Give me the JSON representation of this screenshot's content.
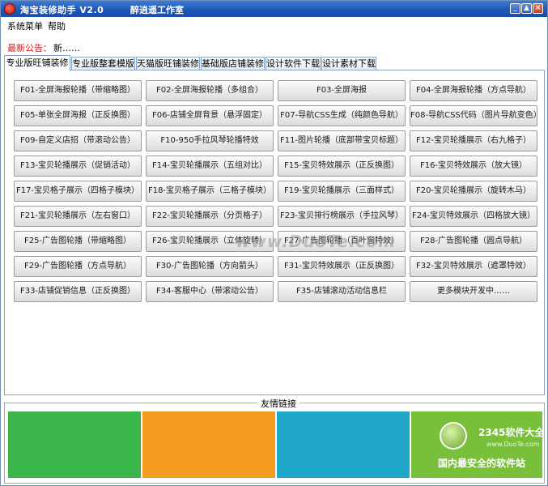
{
  "window": {
    "title": "淘宝装修助手 V2.0",
    "studio": "醉逍遥工作室",
    "controls": [
      "minimize",
      "maximize",
      "close"
    ]
  },
  "menu": {
    "items": [
      "系统菜单",
      "帮助"
    ]
  },
  "notice": {
    "label": "最新公告：",
    "text": "新……"
  },
  "tabs": [
    "专业版旺铺装修",
    "专业版整套模版",
    "天猫版旺铺装修",
    "基础版店铺装修",
    "设计软件下载",
    "设计素材下载"
  ],
  "modules": [
    "F01-全屏海报轮播（带缩略图）",
    "F02-全屏海报轮播（多组合）",
    "F03-全屏海报",
    "F04-全屏海报轮播（方点导航）",
    "F05-单张全屏海报（正反换图）",
    "F06-店铺全屏背景（悬浮固定）",
    "F07-导航CSS生成（纯颜色导航）",
    "F08-导航CSS代码（图片导航变色）",
    "F09-自定义店招（带滚动公告）",
    "F10-950手拉风琴轮播特效",
    "F11-图片轮播（底部带宝贝标题）",
    "F12-宝贝轮播展示（右九格子）",
    "F13-宝贝轮播展示（促销活动）",
    "F14-宝贝轮播展示（五组对比）",
    "F15-宝贝特效展示（正反换图）",
    "F16-宝贝特效展示（放大镜）",
    "F17-宝贝格子展示（四格子模块）",
    "F18-宝贝格子展示（三格子模块）",
    "F19-宝贝轮播展示（三面样式）",
    "F20-宝贝轮播展示（旋转木马）",
    "F21-宝贝轮播展示（左右窗口）",
    "F22-宝贝轮播展示（分页格子）",
    "F23-宝贝排行榜展示（手拉风琴）",
    "F24-宝贝特效展示（四格放大镜）",
    "F25-广告图轮播（带缩略图）",
    "F26-宝贝轮播展示（立体旋转）",
    "F27-广告图轮播（百叶窗特效）",
    "F28-广告图轮播（圆点导航）",
    "F29-广告图轮播（方点导航）",
    "F30-广告图轮播（方向箭头）",
    "F31-宝贝特效展示（正反换图）",
    "F32-宝贝特效展示（遮罩特效）",
    "F33-店铺促销信息（正反换图）",
    "F34-客服中心（带滚动公告）",
    "F35-店铺滚动活动信息栏",
    "更多模块开发中……"
  ],
  "friends": {
    "title": "友情链接",
    "tiles": [
      "#3ab54a",
      "#f39c1f",
      "#1fa8c8",
      "#78c03a"
    ]
  },
  "watermarks": {
    "site": "www.DuoTe.com",
    "logo": "2345软件大全",
    "logo_site": "www.DuoTe.com",
    "slogan": "国内最安全的软件站"
  }
}
